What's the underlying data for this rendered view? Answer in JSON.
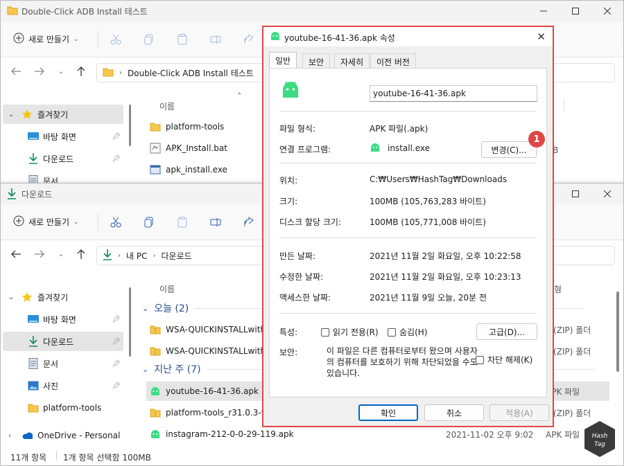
{
  "back_window": {
    "title": "Double-Click ADB Install 테스트",
    "new_label": "새로 만들기",
    "breadcrumb": [
      "Double-Click ADB Install 테스트"
    ],
    "nav_items": [
      {
        "label": "즐겨찾기",
        "icon": "star-icon"
      },
      {
        "label": "바탕 화면",
        "icon": "desktop-icon"
      },
      {
        "label": "다운로드",
        "icon": "download-icon"
      },
      {
        "label": "문서",
        "icon": "document-icon"
      }
    ],
    "column_name": "이름",
    "files": [
      {
        "name": "platform-tools",
        "icon": "folder-icon"
      },
      {
        "name": "APK_Install.bat",
        "icon": "batch-file-icon"
      },
      {
        "name": "apk_install.exe",
        "icon": "exe-icon"
      }
    ],
    "right_fragment": "B"
  },
  "front_window": {
    "title": "다운로드",
    "new_label": "새로 만들기",
    "breadcrumb": [
      "내 PC",
      "다운로드"
    ],
    "nav_items": [
      {
        "label": "즐겨찾기",
        "icon": "star-icon"
      },
      {
        "label": "바탕 화면",
        "icon": "desktop-icon"
      },
      {
        "label": "다운로드",
        "icon": "download-icon"
      },
      {
        "label": "문서",
        "icon": "document-icon"
      },
      {
        "label": "사진",
        "icon": "pictures-icon"
      },
      {
        "label": "platform-tools",
        "icon": "folder-icon"
      },
      {
        "label": "OneDrive - Personal",
        "icon": "onedrive-icon"
      }
    ],
    "column_name": "이름",
    "column_type_fragment": "형",
    "groups": [
      {
        "label": "오늘 (2)"
      },
      {
        "label": "지난 주 (7)"
      }
    ],
    "files": [
      {
        "name": "WSA-QUICKINSTALLwithA",
        "date": "",
        "type": "축(ZIP) 폴더",
        "icon": "zip-folder-icon"
      },
      {
        "name": "WSA-QUICKINSTALLwithA",
        "date": "",
        "type": "축(ZIP) 폴더",
        "icon": "zip-folder-icon"
      },
      {
        "name": "youtube-16-41-36.apk",
        "date": "",
        "type": "APK 파일",
        "icon": "android-icon"
      },
      {
        "name": "platform-tools_r31.0.3-win",
        "date": "",
        "type": "축(ZIP) 폴더",
        "icon": "zip-folder-icon"
      },
      {
        "name": "instagram-212-0-0-29-119.apk",
        "date": "2021-11-02 오후 9:02",
        "type": "APK 파일",
        "icon": "android-icon"
      }
    ],
    "status": {
      "count": "11개 항목",
      "selection": "1개 항목 선택함 100MB"
    }
  },
  "dialog": {
    "title": "youtube-16-41-36.apk 속성",
    "tabs": [
      "일반",
      "보안",
      "자세히",
      "이전 버전"
    ],
    "file_name": "youtube-16-41-36.apk",
    "fields": {
      "file_type_label": "파일 형식:",
      "file_type_value": "APK 파일(.apk)",
      "opens_with_label": "연결 프로그램:",
      "opens_with_value": "install.exe",
      "change_button": "변경(C)...",
      "location_label": "위치:",
      "location_value": "C:₩Users₩HashTag₩Downloads",
      "size_label": "크기:",
      "size_value": "100MB (105,763,283 바이트)",
      "disk_size_label": "디스크 할당 크기:",
      "disk_size_value": "100MB (105,771,008 바이트)",
      "created_label": "만든 날짜:",
      "created_value": "2021년 11월 2일 화요일, 오후 10:22:58",
      "modified_label": "수정한 날짜:",
      "modified_value": "2021년 11월 2일 화요일, 오후 10:23:13",
      "accessed_label": "액세스한 날짜:",
      "accessed_value": "2021년 11월 9일 오늘, 20분 전",
      "attributes_label": "특성:",
      "readonly_label": "읽기 전용(R)",
      "hidden_label": "숨김(H)",
      "advanced_button": "고급(D)...",
      "security_label": "보안:",
      "security_text": "이 파일은 다른 컴퓨터로부터 왔으며 사용자의 컴퓨터를 보호하기 위해 차단되었을 수도 있습니다.",
      "unblock_label": "차단 해제(K)"
    },
    "buttons": {
      "ok": "확인",
      "cancel": "취소",
      "apply": "적용(A)"
    }
  },
  "callout_number": "1",
  "watermark": "Hash Tag",
  "colors": {
    "accent": "#0067c0",
    "highlight_border": "#e04646",
    "android_green": "#3ddc84",
    "folder": "#f8c74e"
  }
}
